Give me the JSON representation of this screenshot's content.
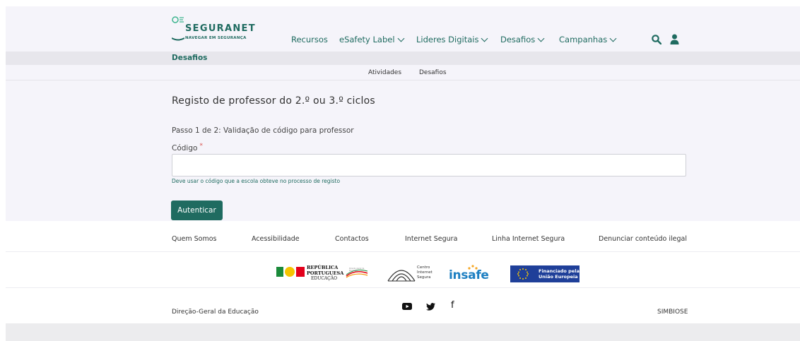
{
  "logo": {
    "brand": "SEGURANET",
    "tagline": "NAVEGAR EM SEGURANÇA"
  },
  "nav": {
    "items": [
      {
        "label": "Recursos",
        "dropdown": false
      },
      {
        "label": "eSafety Label",
        "dropdown": true
      },
      {
        "label": "Lideres Digitais",
        "dropdown": true
      },
      {
        "label": "Desafios",
        "dropdown": true
      },
      {
        "label": "Campanhas",
        "dropdown": true
      }
    ]
  },
  "section": {
    "title": "Desafios"
  },
  "subnav": {
    "items": [
      "Atividades",
      "Desafios"
    ]
  },
  "form": {
    "title": "Registo de professor do 2.º ou 3.º ciclos",
    "step": "Passo 1 de 2: Validação de código para professor",
    "code_label": "Código",
    "required_mark": "*",
    "code_value": "",
    "hint": "Deve usar o código que a escola obteve no processo de registo",
    "submit_label": "Autenticar"
  },
  "footer": {
    "links": [
      "Quem Somos",
      "Acessibilidade",
      "Contactos",
      "Internet Segura",
      "Linha Internet Segura",
      "Denunciar conteúdo ilegal"
    ],
    "partners": {
      "republica": [
        "REPÚBLICA",
        "PORTUGUESA",
        "EDUCAÇÃO"
      ],
      "dge_small": "Direção-Geral da Educação",
      "centro": [
        "Centro",
        "Internet",
        "Segura"
      ],
      "insafe": "insafe",
      "eu": [
        "Financiado pela",
        "União Europeia"
      ]
    },
    "org": "Direção-Geral da Educação",
    "simbiose": "SIMBIOSE"
  },
  "colors": {
    "brand": "#1f6b60",
    "facebook": "#3b5998",
    "x": "#111111",
    "telegram": "#2a9fd6",
    "email": "#7a7a7a"
  }
}
